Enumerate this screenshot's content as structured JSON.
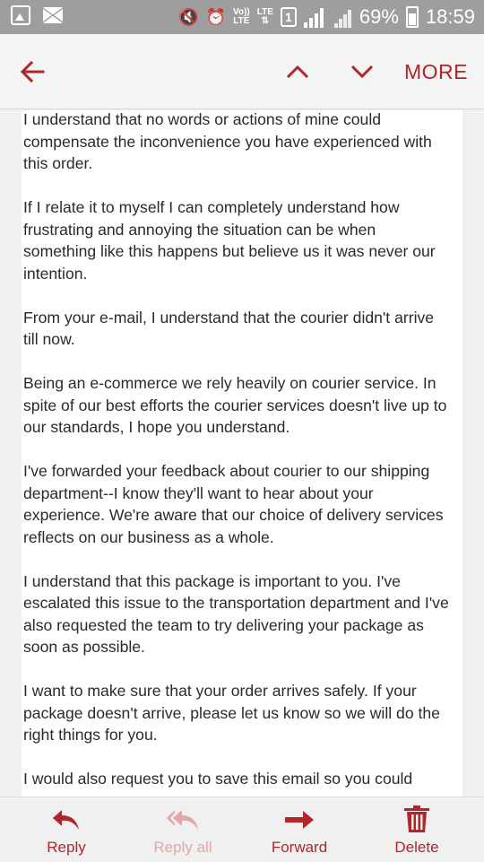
{
  "status_bar": {
    "battery": "69%",
    "time": "18:59",
    "volte_top": "Vo))",
    "volte_bottom": "LTE",
    "lte_label": "LTE",
    "sim": "1"
  },
  "toolbar": {
    "more_label": "MORE"
  },
  "email": {
    "paragraphs": [
      "I understand that no words or actions of mine could compensate the inconvenience you have experienced with this order.",
      "If I relate it to myself I can completely understand how frustrating and annoying the situation can be when something like this happens but believe us it was never our intention.",
      "From your e-mail, I understand that the courier didn't arrive till now.",
      "Being an e-commerce we rely heavily on courier service. In spite of our best efforts the courier services doesn't live up to our standards, I hope you understand.",
      "I've forwarded your feedback about courier to our shipping department--I know they'll want to hear about your experience. We're aware that our choice of delivery services reflects on our business as a whole.",
      "I understand that this package is important to you. I've escalated this issue to the transportation department and I've also requested the team to try delivering your package as soon as possible.",
      "I want to make sure that your order arrives safely. If your package doesn't arrive, please let us know so we will do the right things for you.",
      "I would also request you to save this email so you could"
    ]
  },
  "actions": {
    "reply": "Reply",
    "reply_all": "Reply all",
    "forward": "Forward",
    "delete": "Delete"
  },
  "colors": {
    "accent": "#b0262a",
    "accent_disabled": "#e2a7a9",
    "status_bar": "#9e9e9e"
  },
  "icons": [
    "image-icon",
    "mail-icon",
    "mute-icon",
    "alarm-icon",
    "volte-icon",
    "lte-icon",
    "signal-icon",
    "battery-icon",
    "back-arrow-icon",
    "chevron-up-icon",
    "chevron-down-icon",
    "reply-icon",
    "reply-all-icon",
    "forward-icon",
    "delete-icon"
  ]
}
